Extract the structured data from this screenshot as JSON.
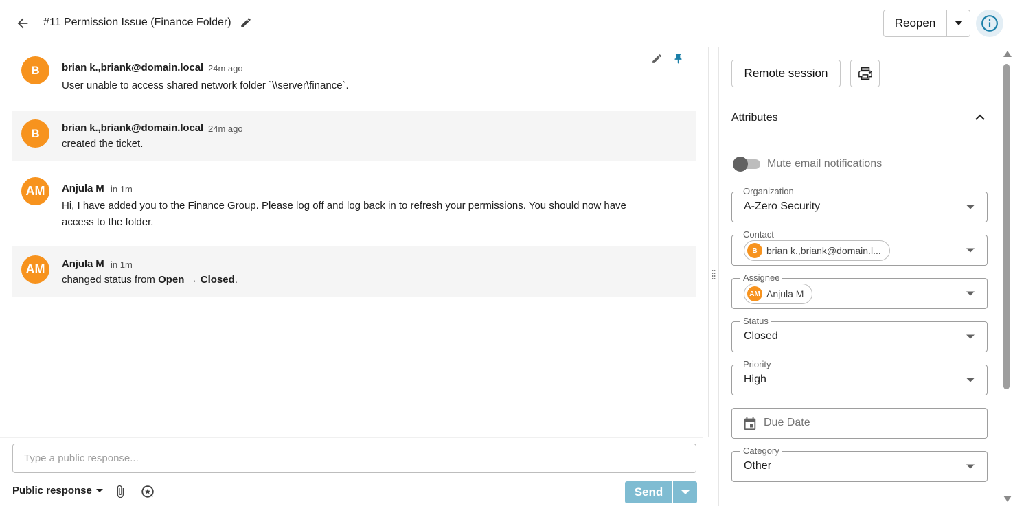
{
  "header": {
    "title": "#11 Permission Issue (Finance Folder)",
    "reopen_label": "Reopen"
  },
  "thread": {
    "messages": [
      {
        "avatar": "B",
        "author": "brian k.,briank@domain.local",
        "time": "24m ago",
        "body": "User unable to access shared network folder `\\\\server\\finance`."
      },
      {
        "avatar": "B",
        "author": "brian k.,briank@domain.local",
        "time": "24m ago",
        "body": "created the ticket."
      },
      {
        "avatar": "AM",
        "author": "Anjula M",
        "time": "in 1m",
        "body_line1": "Hi, I have added you to the Finance Group. Please log off and log back in to refresh your permissions. You should now have",
        "body_line2": "access to the folder."
      },
      {
        "avatar": "AM",
        "author": "Anjula M",
        "time": "in 1m",
        "body_prefix": "changed status from ",
        "from_status": "Open",
        "arrow": " → ",
        "to_status": "Closed",
        "body_suffix": "."
      }
    ]
  },
  "composer": {
    "placeholder": "Type a public response...",
    "response_type": "Public response",
    "send_label": "Send"
  },
  "panel": {
    "remote_session_label": "Remote session",
    "attributes_title": "Attributes",
    "mute_label": "Mute email notifications",
    "mute_on": false,
    "fields": {
      "organization": {
        "legend": "Organization",
        "value": "A-Zero Security"
      },
      "contact": {
        "legend": "Contact",
        "chip_avatar": "B",
        "value": "brian k.,briank@domain.l..."
      },
      "assignee": {
        "legend": "Assignee",
        "chip_avatar": "AM",
        "value": "Anjula M"
      },
      "status": {
        "legend": "Status",
        "value": "Closed"
      },
      "priority": {
        "legend": "Priority",
        "value": "High"
      },
      "due_date": {
        "placeholder": "Due Date"
      },
      "category": {
        "legend": "Category",
        "value": "Other"
      }
    }
  },
  "colors": {
    "avatar": "#f7931e",
    "pin": "#1a7fa8",
    "send": "#7fbcd2",
    "info": "#1a7fa8"
  }
}
